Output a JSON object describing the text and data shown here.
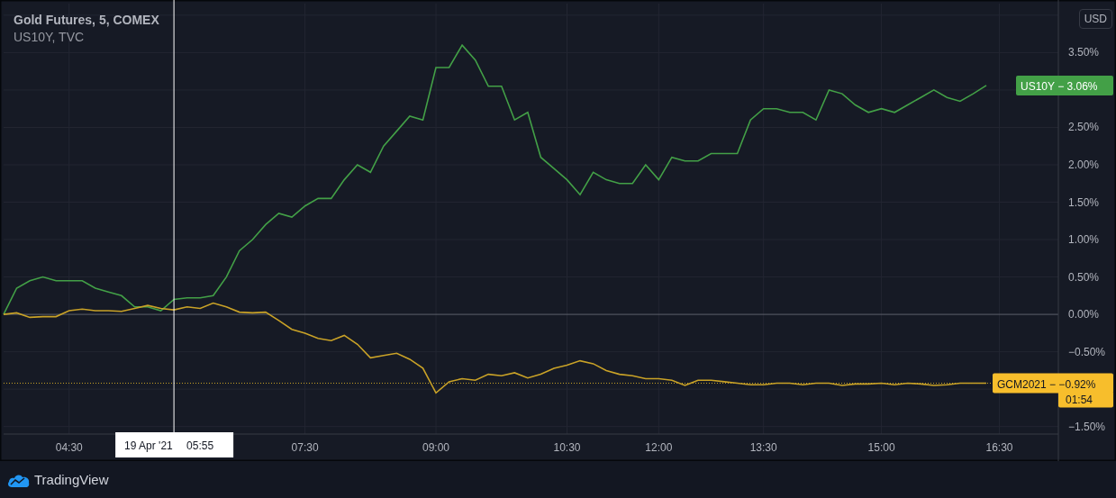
{
  "legend": [
    {
      "text": "Gold Futures, 5, COMEX",
      "bold": true
    },
    {
      "text": "US10Y, TVC",
      "bold": false
    }
  ],
  "currency_button": "USD",
  "chart": {
    "chart_data": {
      "type": "line",
      "grid": true,
      "ylim": [
        -1.6,
        4.155
      ],
      "ref_lines": [
        {
          "axis": "y",
          "value": -0.92,
          "color": "#c9a227"
        }
      ],
      "categories": [
        null,
        null,
        null,
        null,
        null,
        "04:30",
        null,
        null,
        null,
        null,
        null,
        null,
        null,
        null,
        null,
        null,
        null,
        null,
        null,
        null,
        null,
        null,
        null,
        "07:30",
        null,
        null,
        null,
        null,
        null,
        null,
        null,
        null,
        null,
        "09:00",
        null,
        null,
        null,
        null,
        null,
        null,
        null,
        null,
        null,
        "10:30",
        null,
        null,
        null,
        null,
        null,
        null,
        "12:00",
        null,
        null,
        null,
        null,
        null,
        null,
        null,
        "13:30",
        null,
        null,
        null,
        null,
        null,
        null,
        null,
        null,
        "15:00",
        null,
        null,
        null,
        null,
        null,
        null,
        null,
        null,
        "16:30",
        null,
        null,
        null,
        null
      ],
      "yticks": [
        {
          "value": 3.5,
          "label": "3.50%"
        },
        {
          "value": 2.5,
          "label": "2.50%"
        },
        {
          "value": 2,
          "label": "2.00%"
        },
        {
          "value": 1.5,
          "label": "1.50%"
        },
        {
          "value": 1,
          "label": "1.00%"
        },
        {
          "value": 0.5,
          "label": "0.50%"
        },
        {
          "value": 0,
          "label": "0.00%"
        },
        {
          "value": -0.5,
          "label": "−0.50%"
        },
        {
          "value": -1.5,
          "label": "−1.50%"
        }
      ],
      "series": [
        {
          "name": "US10Y",
          "color": "#43a047",
          "values": [
            0,
            0.35,
            0.45,
            0.5,
            0.45,
            0.45,
            0.45,
            0.35,
            0.3,
            0.25,
            0.1,
            0.1,
            0.05,
            0.2,
            0.22,
            0.22,
            0.25,
            0.5,
            0.85,
            1.0,
            1.2,
            1.35,
            1.3,
            1.45,
            1.55,
            1.55,
            1.8,
            2.0,
            1.9,
            2.25,
            2.45,
            2.65,
            2.6,
            3.3,
            3.3,
            3.6,
            3.4,
            3.05,
            3.05,
            2.6,
            2.7,
            2.1,
            1.95,
            1.8,
            1.6,
            1.9,
            1.8,
            1.75,
            1.75,
            2.0,
            1.8,
            2.1,
            2.05,
            2.05,
            2.15,
            2.15,
            2.15,
            2.6,
            2.75,
            2.75,
            2.7,
            2.7,
            2.6,
            3.0,
            2.95,
            2.8,
            2.7,
            2.75,
            2.7,
            2.8,
            2.9,
            3.0,
            2.9,
            2.85,
            2.95,
            3.06,
            null,
            null,
            null,
            null,
            null
          ]
        },
        {
          "name": "GCM2021",
          "color": "#c9a227",
          "values": [
            0,
            0.02,
            -0.04,
            -0.03,
            -0.03,
            0.05,
            0.07,
            0.05,
            0.05,
            0.04,
            0.08,
            0.12,
            0.08,
            0.06,
            0.1,
            0.08,
            0.15,
            0.1,
            0.03,
            0.02,
            0.03,
            -0.08,
            -0.2,
            -0.25,
            -0.32,
            -0.35,
            -0.28,
            -0.4,
            -0.58,
            -0.55,
            -0.52,
            -0.6,
            -0.72,
            -1.05,
            -0.9,
            -0.86,
            -0.88,
            -0.8,
            -0.82,
            -0.78,
            -0.85,
            -0.8,
            -0.72,
            -0.68,
            -0.62,
            -0.66,
            -0.75,
            -0.8,
            -0.82,
            -0.86,
            -0.86,
            -0.88,
            -0.95,
            -0.88,
            -0.88,
            -0.9,
            -0.92,
            -0.94,
            -0.94,
            -0.92,
            -0.92,
            -0.94,
            -0.92,
            -0.92,
            -0.95,
            -0.93,
            -0.93,
            -0.92,
            -0.94,
            -0.92,
            -0.93,
            -0.95,
            -0.94,
            -0.92,
            -0.92,
            -0.92,
            null,
            null,
            null,
            null,
            null
          ]
        }
      ]
    },
    "crosshair": {
      "date": "19 Apr '21",
      "time": "05:55"
    },
    "price_tags": [
      {
        "separator": "−",
        "value": "3.06%",
        "color": "#43a047"
      },
      {
        "separator": "−",
        "value": "−0.92%",
        "countdown": "01:54",
        "color": "#f7be2c"
      }
    ]
  },
  "footer": {
    "brand": "TradingView"
  }
}
